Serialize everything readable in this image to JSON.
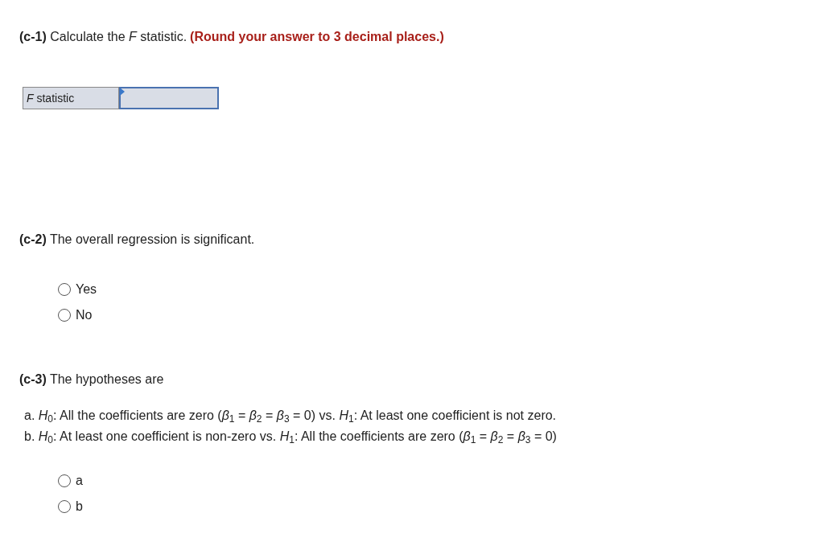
{
  "parts": [
    {
      "kind": "input",
      "heading": "**(c-1)** Calculate the *F* statistic.",
      "note": "(Round your answer to 3 decimal places.)",
      "field": {
        "label": "*F* statistic"
      }
    },
    {
      "kind": "radio",
      "heading": "**(c-2)** The overall regression is significant.",
      "options": [
        {
          "label": "Yes",
          "selected": false
        },
        {
          "label": "No",
          "selected": false
        }
      ]
    },
    {
      "kind": "radio",
      "heading": "**(c-3)** The hypotheses are",
      "statements": [
        "a. *H*$_{0}$: All the coefficients are zero (*β*$_{1}$ = *β*$_{2}$ = *β*$_{3}$ = 0) vs. *H*$_{1}$: At least one coefficient is not zero.",
        "b. *H*$_{0}$: At least one coefficient is non-zero vs. *H*$_{1}$: All the coefficients are zero (*β*$_{1}$ = *β*$_{2}$ = *β*$_{3}$ = 0)"
      ],
      "options": [
        {
          "label": "a",
          "selected": false
        },
        {
          "label": "b",
          "selected": false
        }
      ]
    }
  ]
}
